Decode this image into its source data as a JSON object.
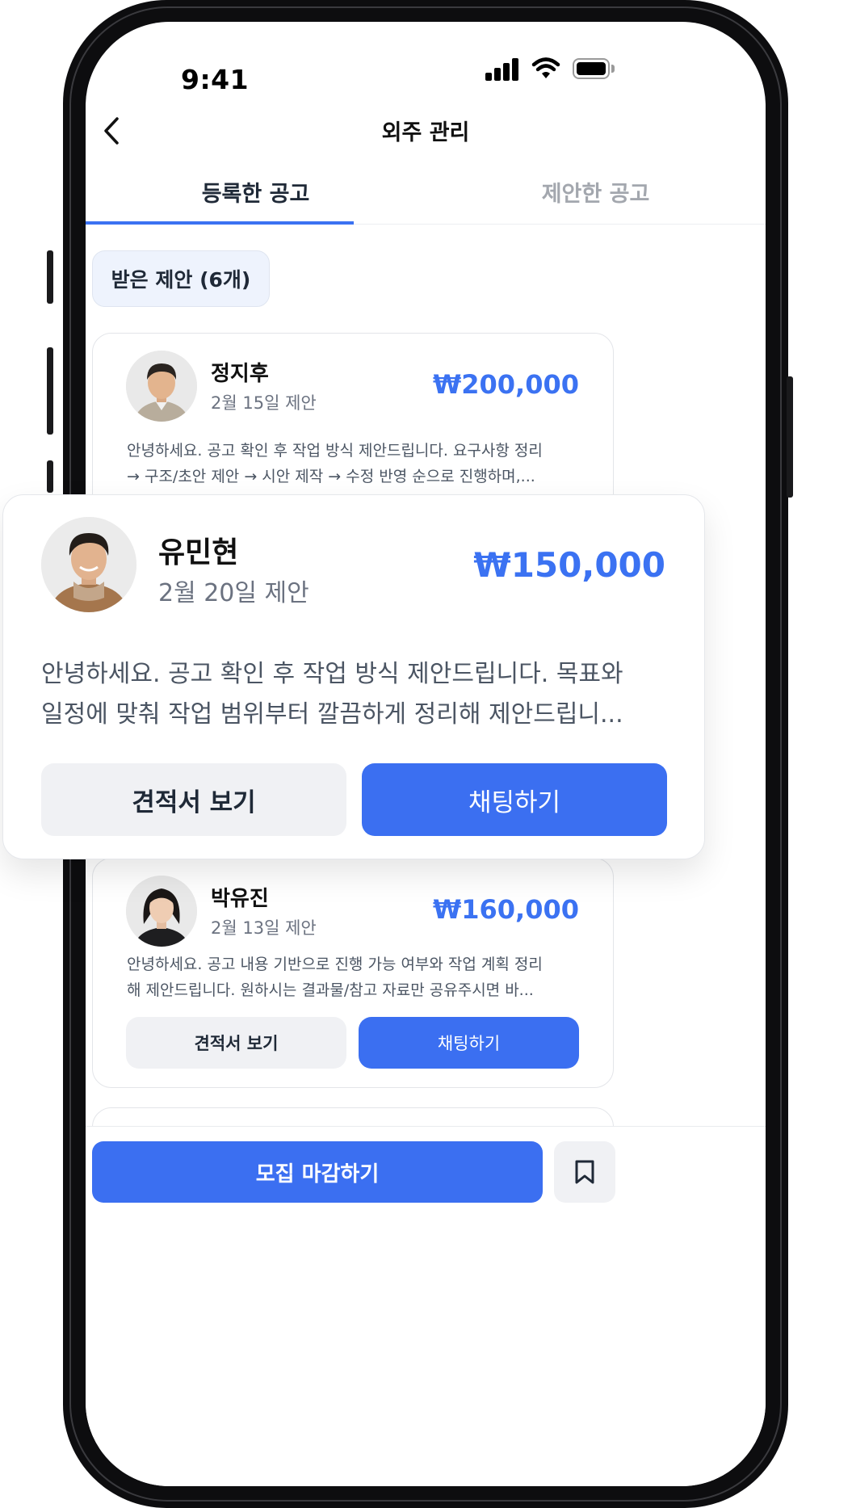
{
  "status_bar": {
    "time": "9:41"
  },
  "header": {
    "title": "외주 관리"
  },
  "tabs": [
    {
      "label": "등록한 공고",
      "active": true
    },
    {
      "label": "제안한 공고",
      "active": false
    }
  ],
  "filter": {
    "label": "받은 제안 (6개)"
  },
  "proposals": [
    {
      "name": "정지후",
      "date": "2월 15일 제안",
      "price": "₩200,000",
      "desc_line1": "안녕하세요. 공고 확인 후 작업 방식 제안드립니다. 요구사항 정리",
      "desc_line2": "→ 구조/초안 제안 → 시안 제작 → 수정 반영 순으로 진행하며,..."
    },
    {
      "name": "유민현",
      "date": "2월 20일 제안",
      "price": "₩150,000",
      "desc_line1": "안녕하세요. 공고 확인 후 작업 방식 제안드립니다. 목표와",
      "desc_line2": "일정에 맞춰 작업 범위부터 깔끔하게 정리해 제안드립니...",
      "quote_label": "견적서 보기",
      "chat_label": "채팅하기"
    },
    {
      "name": "박유진",
      "date": "2월 13일 제안",
      "price": "₩160,000",
      "desc_line1": "안녕하세요. 공고 내용 기반으로 진행 가능 여부와 작업 계획 정리",
      "desc_line2": "해 제안드립니다. 원하시는 결과물/참고 자료만 공유주시면 바...",
      "quote_label": "견적서 보기",
      "chat_label": "채팅하기"
    }
  ],
  "bottom": {
    "close_label": "모집 마감하기"
  },
  "colors": {
    "accent": "#3b6ff1",
    "price": "#3b72f2",
    "chip_bg": "#eef3fd",
    "gray_button": "#f0f1f4"
  },
  "icons": [
    "back-chevron-icon",
    "signal-icon",
    "wifi-icon",
    "battery-icon",
    "bookmark-icon"
  ]
}
